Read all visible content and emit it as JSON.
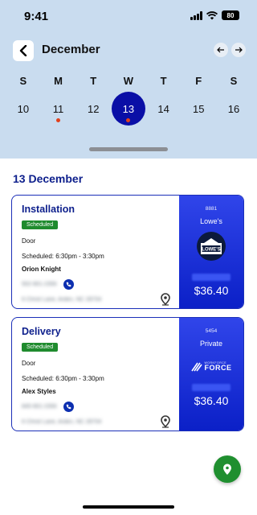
{
  "status_bar": {
    "time": "9:41",
    "battery": "80"
  },
  "header": {
    "month": "December"
  },
  "calendar": {
    "weekdays": [
      "S",
      "M",
      "T",
      "W",
      "T",
      "F",
      "S"
    ],
    "dates": [
      {
        "num": "10",
        "dot": false,
        "selected": false
      },
      {
        "num": "11",
        "dot": true,
        "selected": false
      },
      {
        "num": "12",
        "dot": false,
        "selected": false
      },
      {
        "num": "13",
        "dot": true,
        "selected": true
      },
      {
        "num": "14",
        "dot": false,
        "selected": false
      },
      {
        "num": "15",
        "dot": false,
        "selected": false
      },
      {
        "num": "16",
        "dot": false,
        "selected": false
      }
    ]
  },
  "section_title": "13 December",
  "jobs": [
    {
      "title": "Installation",
      "status": "Scheduled",
      "item": "Door",
      "schedule": "Scheduled: 6:30pm - 3:30pm",
      "customer": "Orion Knight",
      "phone": "502-901-2356",
      "address": "6 Christ Lane, Arden, NC 28704",
      "code": "8881",
      "merchant": "Lowe's",
      "amount": "$36.40"
    },
    {
      "title": "Delivery",
      "status": "Scheduled",
      "item": "Door",
      "schedule": "Scheduled: 6:30pm - 3:30pm",
      "customer": "Alex Styles",
      "phone": "845-901-2356",
      "address": "6 Christ Lane, Arden, NC 28704",
      "code": "5454",
      "merchant": "Private",
      "amount": "$36.40"
    }
  ],
  "colors": {
    "header_bg": "#c9dcef",
    "accent": "#0a0fa6",
    "title_blue": "#0d1f8c",
    "badge_green": "#1f8b2e",
    "dot_red": "#e2401b",
    "card_panel": "#0b20c7"
  }
}
